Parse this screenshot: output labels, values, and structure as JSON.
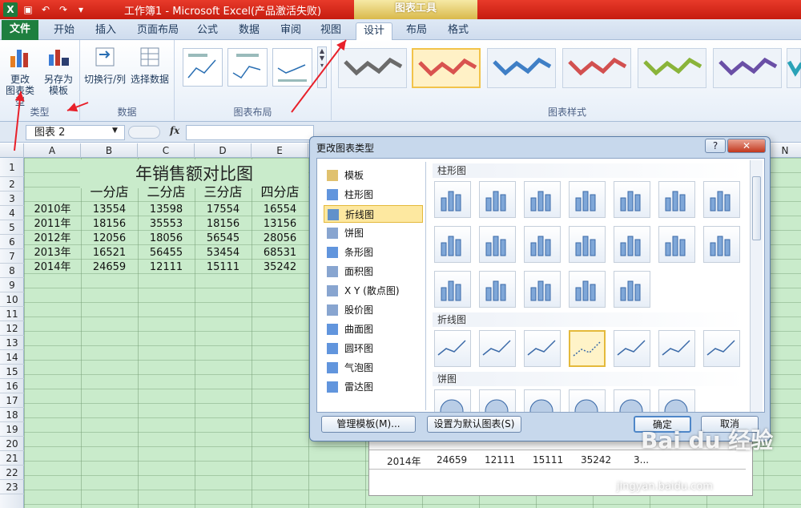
{
  "window": {
    "title": "工作簿1 - Microsoft Excel(产品激活失败)",
    "context_tab": "图表工具",
    "logo": "X"
  },
  "tabs": [
    "文件",
    "开始",
    "插入",
    "页面布局",
    "公式",
    "数据",
    "审阅",
    "视图",
    "设计",
    "布局",
    "格式"
  ],
  "ribbon": {
    "groups": {
      "type": "类型",
      "data": "数据",
      "layout": "图表布局",
      "styles": "图表样式"
    },
    "buttons": {
      "change_type_l1": "更改",
      "change_type_l2": "图表类型",
      "save_template_l1": "另存为",
      "save_template_l2": "模板",
      "switch_row_col": "切换行/列",
      "select_data": "选择数据"
    },
    "style_colors": [
      "#6b6b6b",
      "#d9534f",
      "#3f7fc6",
      "#d25050",
      "#8ab43a",
      "#6a4fa6",
      "#2aa2b7"
    ]
  },
  "formula_bar": {
    "name_box": "图表 2",
    "fx": "fx"
  },
  "sheet": {
    "columns": [
      "A",
      "B",
      "C",
      "D",
      "E",
      "N"
    ],
    "rows": [
      "1",
      "2",
      "3",
      "4",
      "5",
      "6",
      "7",
      "8",
      "9",
      "10",
      "11",
      "12",
      "13",
      "14",
      "15",
      "16",
      "17",
      "18",
      "19",
      "20",
      "21",
      "22",
      "23"
    ],
    "title": "年销售额对比图",
    "headers": [
      "一分店",
      "二分店",
      "三分店",
      "四分店"
    ],
    "data": [
      {
        "year": "2010年",
        "values": [
          "13554",
          "13598",
          "17554",
          "16554"
        ]
      },
      {
        "year": "2011年",
        "values": [
          "18156",
          "35553",
          "18156",
          "13156"
        ]
      },
      {
        "year": "2012年",
        "values": [
          "12056",
          "18056",
          "56545",
          "28056"
        ]
      },
      {
        "year": "2013年",
        "values": [
          "16521",
          "56455",
          "53454",
          "68531"
        ]
      },
      {
        "year": "2014年",
        "values": [
          "24659",
          "12111",
          "15111",
          "35242"
        ]
      }
    ],
    "chart_table_row": {
      "year": "2014年",
      "values": [
        "24659",
        "12111",
        "15111",
        "35242",
        "3..."
      ]
    }
  },
  "dialog": {
    "title": "更改图表类型",
    "help": "?",
    "close": "✕",
    "chart_types": [
      "模板",
      "柱形图",
      "折线图",
      "饼图",
      "条形图",
      "面积图",
      "X Y (散点图)",
      "股价图",
      "曲面图",
      "圆环图",
      "气泡图",
      "雷达图"
    ],
    "selected_type": "折线图",
    "sections": {
      "column": "柱形图",
      "line": "折线图",
      "pie": "饼图"
    },
    "buttons": {
      "manage_templates": "管理模板(M)...",
      "set_default": "设置为默认图表(S)",
      "ok": "确定",
      "cancel": "取消"
    }
  },
  "watermark": {
    "brand": "Bai du 经验",
    "url": "jingyan.baidu.com"
  }
}
